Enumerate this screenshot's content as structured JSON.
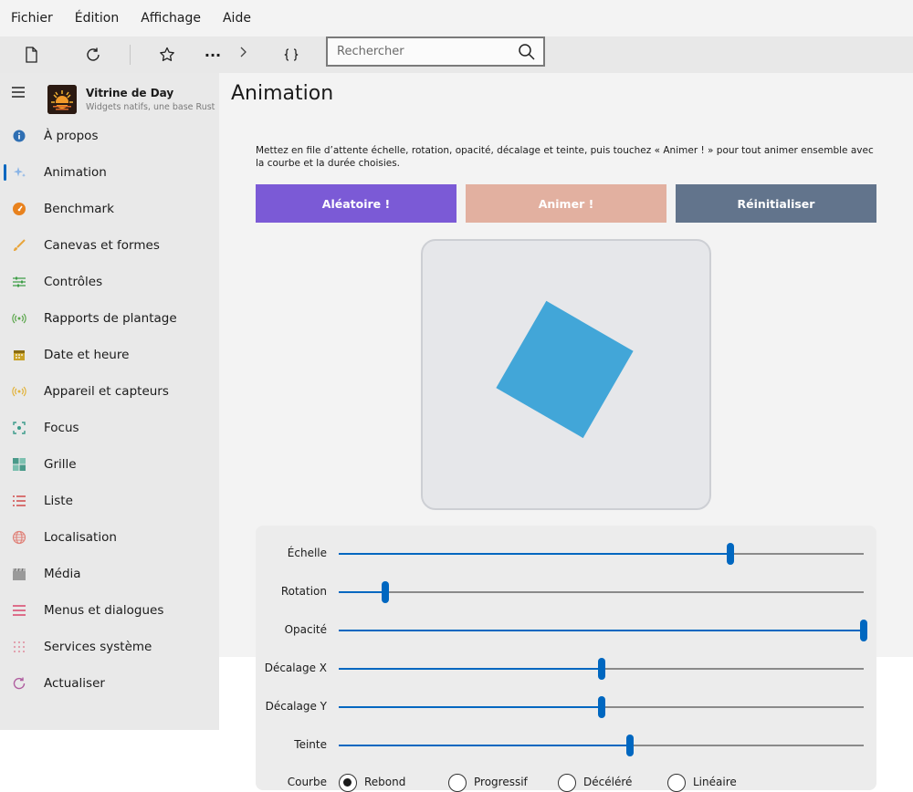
{
  "menu": [
    "Fichier",
    "Édition",
    "Affichage",
    "Aide"
  ],
  "search": {
    "placeholder": "Rechercher"
  },
  "app": {
    "title": "Vitrine de Day",
    "subtitle": "Widgets natifs, une base Rust"
  },
  "nav": [
    {
      "label": "À propos",
      "icon": "info-icon",
      "color": "#2f6fb3"
    },
    {
      "label": "Animation",
      "icon": "sparkle-icon",
      "color": "#8ab4e6"
    },
    {
      "label": "Benchmark",
      "icon": "speedometer-icon",
      "color": "#e8821e"
    },
    {
      "label": "Canevas et formes",
      "icon": "brush-icon",
      "color": "#e8a53c"
    },
    {
      "label": "Contrôles",
      "icon": "sliders-icon",
      "color": "#3f9e48"
    },
    {
      "label": "Rapports de plantage",
      "icon": "broadcast-icon",
      "color": "#5aa64a"
    },
    {
      "label": "Date et heure",
      "icon": "calendar-icon",
      "color": "#c9a227"
    },
    {
      "label": "Appareil et capteurs",
      "icon": "sensor-icon",
      "color": "#e2b23a"
    },
    {
      "label": "Focus",
      "icon": "focus-icon",
      "color": "#3a9b8a"
    },
    {
      "label": "Grille",
      "icon": "grid-icon",
      "color": "#4a9a8a"
    },
    {
      "label": "Liste",
      "icon": "list-icon",
      "color": "#d14b4b"
    },
    {
      "label": "Localisation",
      "icon": "globe-icon",
      "color": "#e0837a"
    },
    {
      "label": "Média",
      "icon": "clapper-icon",
      "color": "#9a9a9a"
    },
    {
      "label": "Menus et dialogues",
      "icon": "menu-lines-icon",
      "color": "#d9456a"
    },
    {
      "label": "Services système",
      "icon": "dots-grid-icon",
      "color": "#e09aa8"
    },
    {
      "label": "Actualiser",
      "icon": "refresh-icon",
      "color": "#b05fa0"
    }
  ],
  "selected_nav": "Animation",
  "page": {
    "title": "Animation",
    "description": "Mettez en file d’attente échelle, rotation, opacité, décalage et teinte, puis touchez « Animer ! » pour tout animer ensemble avec la courbe et la durée choisies."
  },
  "buttons": [
    {
      "label": "Aléatoire !",
      "color": "#7b5ad6"
    },
    {
      "label": "Animer !",
      "color": "#e2b0a0"
    },
    {
      "label": "Réinitialiser",
      "color": "#62748c"
    }
  ],
  "preview": {
    "shape_color": "#42a6d8",
    "rotation_deg": 30
  },
  "sliders": [
    {
      "label": "Échelle",
      "value": 0.746
    },
    {
      "label": "Rotation",
      "value": 0.089
    },
    {
      "label": "Opacité",
      "value": 1.0
    },
    {
      "label": "Décalage X",
      "value": 0.5
    },
    {
      "label": "Décalage Y",
      "value": 0.5
    },
    {
      "label": "Teinte",
      "value": 0.555
    }
  ],
  "curve": {
    "label": "Courbe",
    "options": [
      "Rebond",
      "Progressif",
      "Décéléré",
      "Linéaire"
    ],
    "selected": 0
  },
  "colors": {
    "accent": "#0067c0"
  }
}
